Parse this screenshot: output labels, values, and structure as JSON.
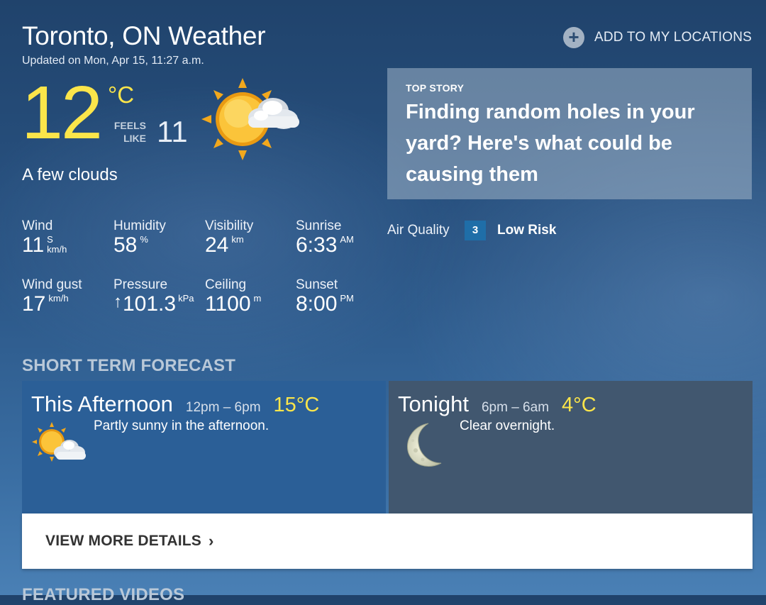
{
  "header": {
    "title": "Toronto, ON Weather",
    "updated": "Updated on Mon, Apr 15, 11:27 a.m.",
    "add_location_label": "ADD TO MY LOCATIONS",
    "add_location_icon": "plus-circle-icon"
  },
  "current": {
    "temperature": "12",
    "unit": "°C",
    "feels_like_label_1": "FEELS",
    "feels_like_label_2": "LIKE",
    "feels_like_value": "11",
    "condition": "A few clouds",
    "icon": "sun-cloud-icon"
  },
  "stats": {
    "wind": {
      "label": "Wind",
      "value": "11",
      "direction": "S",
      "unit": "km/h"
    },
    "humidity": {
      "label": "Humidity",
      "value": "58",
      "unit": "%"
    },
    "visibility": {
      "label": "Visibility",
      "value": "24",
      "unit": "km"
    },
    "sunrise": {
      "label": "Sunrise",
      "value": "6:33",
      "unit": "AM"
    },
    "wind_gust": {
      "label": "Wind gust",
      "value": "17",
      "unit": "km/h"
    },
    "pressure": {
      "label": "Pressure",
      "trend": "↑",
      "value": "101.3",
      "unit": "kPa"
    },
    "ceiling": {
      "label": "Ceiling",
      "value": "1100",
      "unit": "m"
    },
    "sunset": {
      "label": "Sunset",
      "value": "8:00",
      "unit": "PM"
    }
  },
  "top_story": {
    "kicker": "TOP STORY",
    "headline": "Finding random holes in your yard? Here's what could be causing them"
  },
  "air_quality": {
    "label": "Air Quality",
    "index": "3",
    "risk": "Low Risk"
  },
  "short_term": {
    "heading": "SHORT TERM FORECAST",
    "periods": [
      {
        "name": "This Afternoon",
        "time": "12pm – 6pm",
        "temp": "15°C",
        "description": "Partly sunny in the afternoon.",
        "icon": "partly-sunny-icon"
      },
      {
        "name": "Tonight",
        "time": "6pm – 6am",
        "temp": "4°C",
        "description": "Clear overnight.",
        "icon": "moon-icon"
      }
    ],
    "details_label": "VIEW MORE DETAILS"
  },
  "featured": {
    "heading": "FEATURED VIDEOS"
  },
  "colors": {
    "temp_yellow": "#fbe54a",
    "afternoon_panel": "#2b5f97",
    "tonight_panel": "#41576f",
    "aq_badge": "#1f6ea8"
  }
}
